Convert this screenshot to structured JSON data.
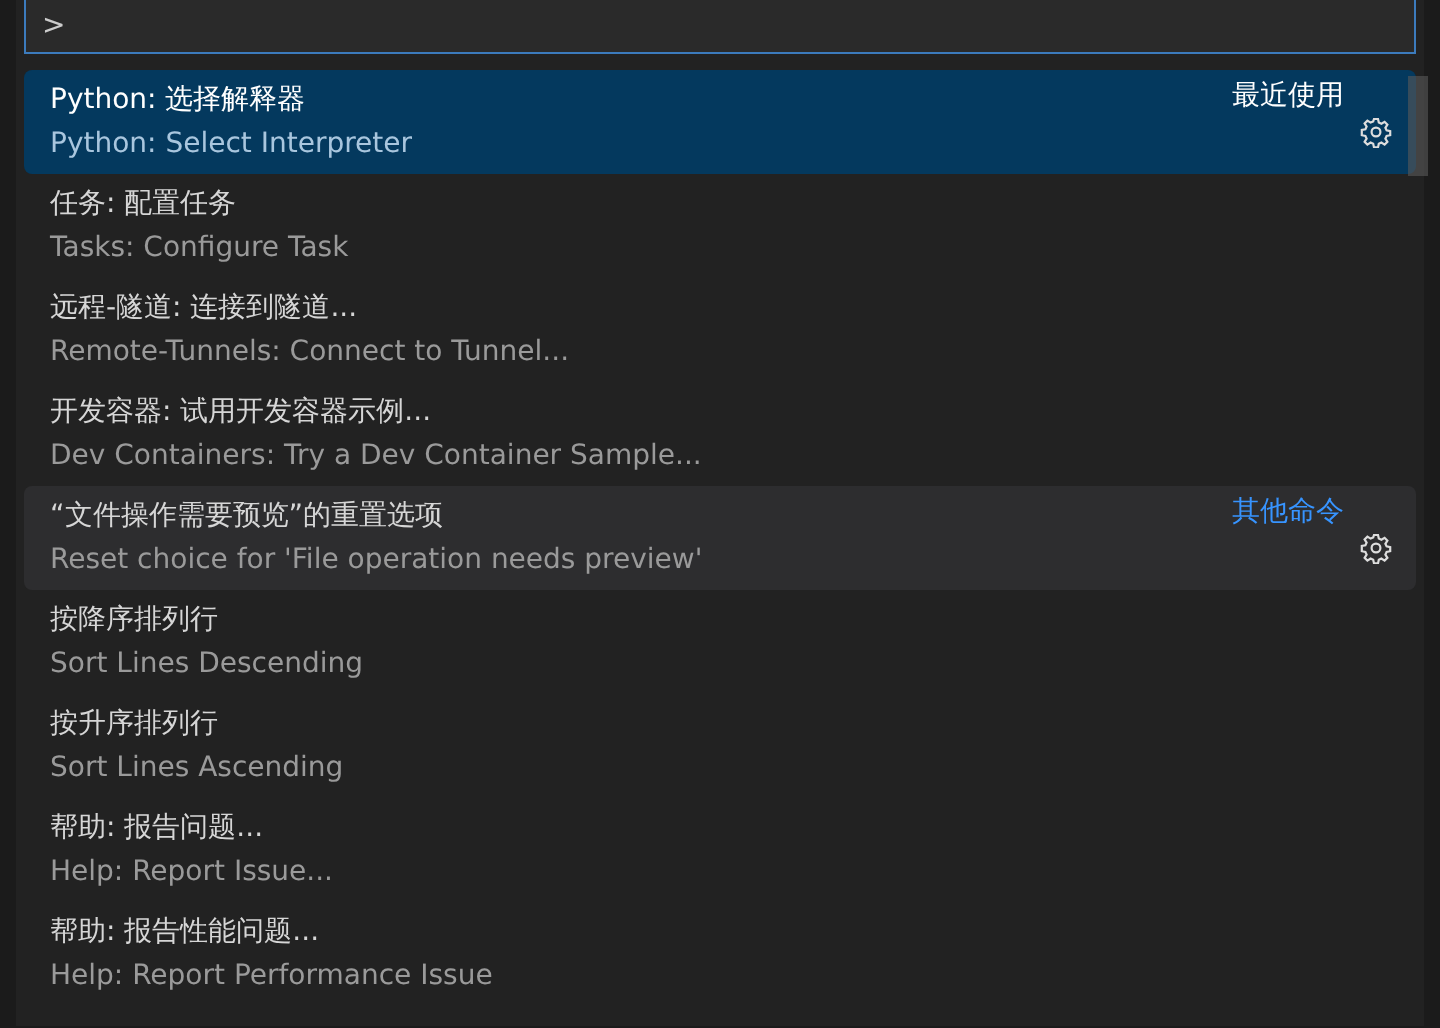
{
  "input": {
    "value": ">"
  },
  "items": [
    {
      "label": "Python: 选择解释器",
      "detail": "Python: Select Interpreter",
      "tag": "最近使用",
      "selected": true,
      "hovered": false
    },
    {
      "label": "任务: 配置任务",
      "detail": "Tasks: Configure Task",
      "selected": false,
      "hovered": false
    },
    {
      "label": "远程-隧道: 连接到隧道...",
      "detail": "Remote-Tunnels: Connect to Tunnel...",
      "selected": false,
      "hovered": false
    },
    {
      "label": "开发容器: 试用开发容器示例...",
      "detail": "Dev Containers: Try a Dev Container Sample...",
      "selected": false,
      "hovered": false
    },
    {
      "label": "“文件操作需要预览”的重置选项",
      "detail": "Reset choice for 'File operation needs preview'",
      "tag": "其他命令",
      "selected": false,
      "hovered": true
    },
    {
      "label": "按降序排列行",
      "detail": "Sort Lines Descending",
      "selected": false,
      "hovered": false
    },
    {
      "label": "按升序排列行",
      "detail": "Sort Lines Ascending",
      "selected": false,
      "hovered": false
    },
    {
      "label": "帮助: 报告问题...",
      "detail": "Help: Report Issue...",
      "selected": false,
      "hovered": false
    },
    {
      "label": "帮助: 报告性能问题...",
      "detail": "Help: Report Performance Issue",
      "selected": false,
      "hovered": false
    }
  ]
}
